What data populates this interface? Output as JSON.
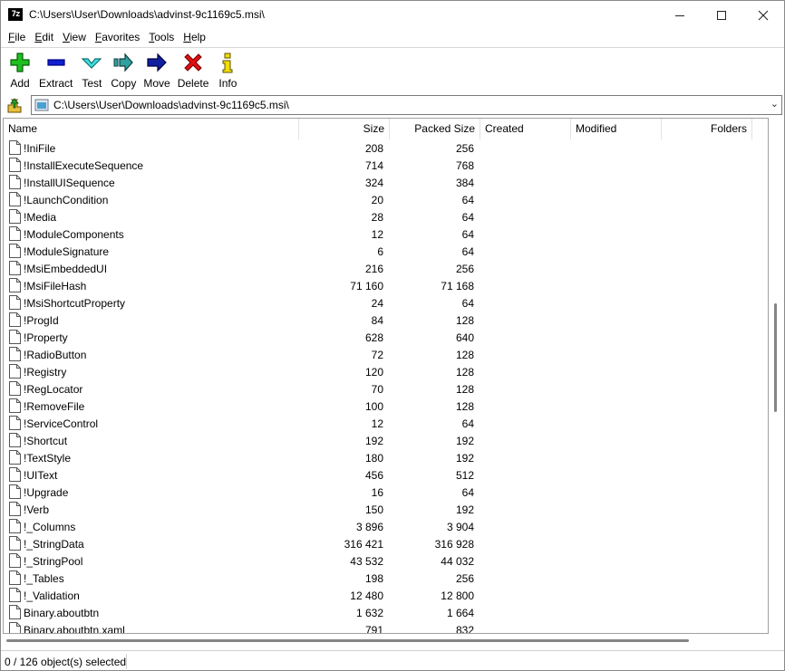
{
  "window": {
    "title": "C:\\Users\\User\\Downloads\\advinst-9c1169c5.msi\\",
    "app_icon_text": "7z"
  },
  "menu": [
    {
      "label": "File",
      "u": "F",
      "rest": "ile"
    },
    {
      "label": "Edit",
      "u": "E",
      "rest": "dit"
    },
    {
      "label": "View",
      "u": "V",
      "rest": "iew"
    },
    {
      "label": "Favorites",
      "u": "F",
      "rest": "avorites",
      "pre": ""
    },
    {
      "label": "Tools",
      "u": "T",
      "rest": "ools"
    },
    {
      "label": "Help",
      "u": "H",
      "rest": "elp"
    }
  ],
  "toolbar": {
    "add": "Add",
    "extract": "Extract",
    "test": "Test",
    "copy": "Copy",
    "move": "Move",
    "delete": "Delete",
    "info": "Info"
  },
  "address": {
    "path": "C:\\Users\\User\\Downloads\\advinst-9c1169c5.msi\\"
  },
  "columns": {
    "name": "Name",
    "size": "Size",
    "packed": "Packed Size",
    "created": "Created",
    "modified": "Modified",
    "folders": "Folders"
  },
  "files": [
    {
      "name": "!IniFile",
      "size": "208",
      "packed": "256"
    },
    {
      "name": "!InstallExecuteSequence",
      "size": "714",
      "packed": "768"
    },
    {
      "name": "!InstallUISequence",
      "size": "324",
      "packed": "384"
    },
    {
      "name": "!LaunchCondition",
      "size": "20",
      "packed": "64"
    },
    {
      "name": "!Media",
      "size": "28",
      "packed": "64"
    },
    {
      "name": "!ModuleComponents",
      "size": "12",
      "packed": "64"
    },
    {
      "name": "!ModuleSignature",
      "size": "6",
      "packed": "64"
    },
    {
      "name": "!MsiEmbeddedUI",
      "size": "216",
      "packed": "256"
    },
    {
      "name": "!MsiFileHash",
      "size": "71 160",
      "packed": "71 168"
    },
    {
      "name": "!MsiShortcutProperty",
      "size": "24",
      "packed": "64"
    },
    {
      "name": "!ProgId",
      "size": "84",
      "packed": "128"
    },
    {
      "name": "!Property",
      "size": "628",
      "packed": "640"
    },
    {
      "name": "!RadioButton",
      "size": "72",
      "packed": "128"
    },
    {
      "name": "!Registry",
      "size": "120",
      "packed": "128"
    },
    {
      "name": "!RegLocator",
      "size": "70",
      "packed": "128"
    },
    {
      "name": "!RemoveFile",
      "size": "100",
      "packed": "128"
    },
    {
      "name": "!ServiceControl",
      "size": "12",
      "packed": "64"
    },
    {
      "name": "!Shortcut",
      "size": "192",
      "packed": "192"
    },
    {
      "name": "!TextStyle",
      "size": "180",
      "packed": "192"
    },
    {
      "name": "!UIText",
      "size": "456",
      "packed": "512"
    },
    {
      "name": "!Upgrade",
      "size": "16",
      "packed": "64"
    },
    {
      "name": "!Verb",
      "size": "150",
      "packed": "192"
    },
    {
      "name": "!_Columns",
      "size": "3 896",
      "packed": "3 904"
    },
    {
      "name": "!_StringData",
      "size": "316 421",
      "packed": "316 928"
    },
    {
      "name": "!_StringPool",
      "size": "43 532",
      "packed": "44 032"
    },
    {
      "name": "!_Tables",
      "size": "198",
      "packed": "256"
    },
    {
      "name": "!_Validation",
      "size": "12 480",
      "packed": "12 800"
    },
    {
      "name": "Binary.aboutbtn",
      "size": "1 632",
      "packed": "1 664"
    },
    {
      "name": "Binary.aboutbtn.xaml",
      "size": "791",
      "packed": "832"
    }
  ],
  "status": {
    "selection": "0 / 126 object(s) selected"
  },
  "scroll": {
    "vertical_position": 0.45,
    "horizontal_visible_fraction": 0.9
  },
  "icons": {
    "add": "plus-icon",
    "extract": "minus-icon",
    "test": "check-chevron-icon",
    "copy": "copy-arrow-icon",
    "move": "move-arrow-icon",
    "delete": "x-icon",
    "info": "info-icon"
  }
}
